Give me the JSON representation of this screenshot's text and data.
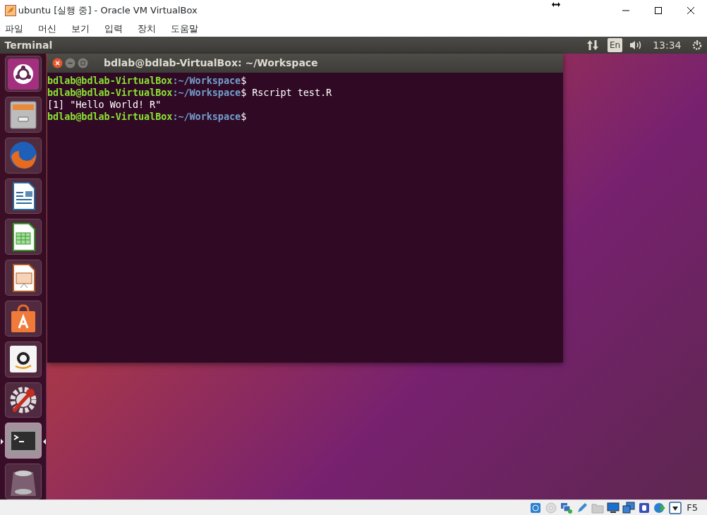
{
  "window": {
    "title": "ubuntu [실행 중] - Oracle VM VirtualBox"
  },
  "menu": [
    "파일",
    "머신",
    "보기",
    "입력",
    "장치",
    "도움말"
  ],
  "top_panel": {
    "app_title": "Terminal",
    "keyboard": "En",
    "time": "13:34"
  },
  "launcher": [
    {
      "kind": "dash",
      "active": false
    },
    {
      "kind": "files",
      "active": false
    },
    {
      "kind": "browser",
      "active": false
    },
    {
      "kind": "writer",
      "active": false
    },
    {
      "kind": "calc",
      "active": false
    },
    {
      "kind": "impress",
      "active": false
    },
    {
      "kind": "store",
      "active": false
    },
    {
      "kind": "amazon",
      "active": false
    },
    {
      "kind": "settings",
      "active": false
    },
    {
      "kind": "terminal",
      "active": true
    },
    {
      "kind": "trash",
      "active": false
    }
  ],
  "terminal": {
    "title": "bdlab@bdlab-VirtualBox: ~/Workspace",
    "lines": [
      {
        "kind": "prompt",
        "user": "bdlab@bdlab-VirtualBox",
        "path": ":~/Workspace",
        "symbol": "$"
      },
      {
        "kind": "prompt",
        "user": "bdlab@bdlab-VirtualBox",
        "path": ":~/Workspace",
        "symbol": "$",
        "command": "Rscript test.R"
      },
      {
        "kind": "output",
        "text": "[1] \"Hello World! R\""
      },
      {
        "kind": "prompt",
        "user": "bdlab@bdlab-VirtualBox",
        "path": ":~/Workspace",
        "symbol": "$"
      }
    ]
  },
  "status_bar": {
    "host_key": "F5"
  }
}
